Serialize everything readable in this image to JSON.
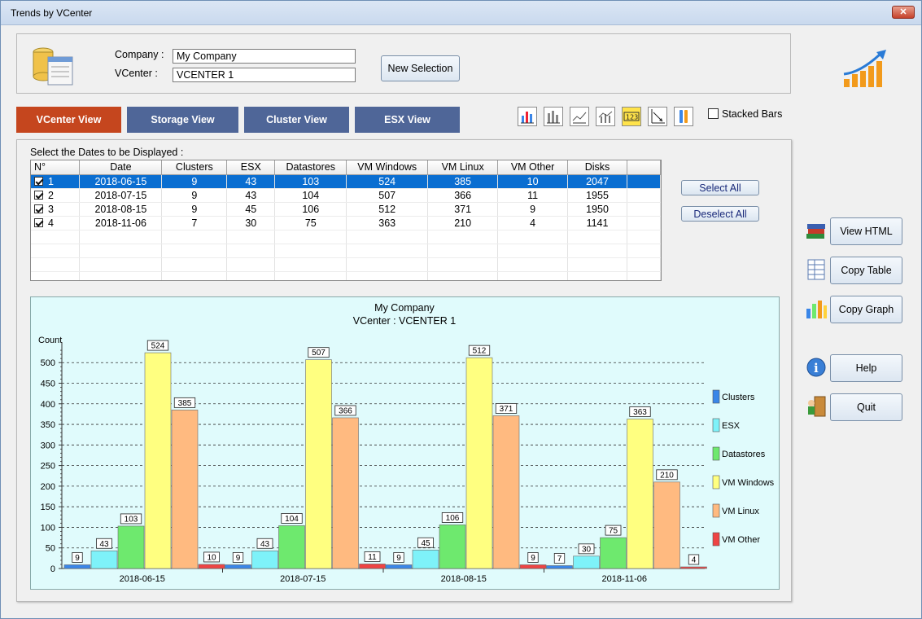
{
  "window": {
    "title": "Trends by VCenter",
    "close_icon": "close-icon"
  },
  "selection": {
    "company_label": "Company :",
    "company_value": "My Company",
    "vcenter_label": "VCenter :",
    "vcenter_value": "VCENTER 1",
    "new_selection": "New Selection"
  },
  "tabs": [
    {
      "label": "VCenter View",
      "active": true,
      "color": "#c5461e"
    },
    {
      "label": "Storage View",
      "active": false,
      "color": "#4f6698"
    },
    {
      "label": "Cluster View",
      "active": false,
      "color": "#4f6698"
    },
    {
      "label": "ESX View",
      "active": false,
      "color": "#4f6698"
    }
  ],
  "toolbar": {
    "icons": [
      "bar-chart-icon",
      "bar-chart-3d-icon",
      "line-chart-icon",
      "line-bar-chart-icon",
      "number-labels-icon",
      "axis-icon",
      "settings-icon"
    ],
    "stacked_label": "Stacked Bars",
    "stacked_checked": false
  },
  "dates": {
    "prompt": "Select the Dates to be Displayed  :",
    "columns": [
      "N°",
      "Date",
      "Clusters",
      "ESX",
      "Datastores",
      "VM Windows",
      "VM Linux",
      "VM Other",
      "Disks"
    ],
    "rows": [
      {
        "n": "1",
        "date": "2018-06-15",
        "clusters": "9",
        "esx": "43",
        "datastores": "103",
        "vmwin": "524",
        "vmlinux": "385",
        "vmother": "10",
        "disks": "2047",
        "checked": true,
        "selected": true
      },
      {
        "n": "2",
        "date": "2018-07-15",
        "clusters": "9",
        "esx": "43",
        "datastores": "104",
        "vmwin": "507",
        "vmlinux": "366",
        "vmother": "11",
        "disks": "1955",
        "checked": true,
        "selected": false
      },
      {
        "n": "3",
        "date": "2018-08-15",
        "clusters": "9",
        "esx": "45",
        "datastores": "106",
        "vmwin": "512",
        "vmlinux": "371",
        "vmother": "9",
        "disks": "1950",
        "checked": true,
        "selected": false
      },
      {
        "n": "4",
        "date": "2018-11-06",
        "clusters": "7",
        "esx": "30",
        "datastores": "75",
        "vmwin": "363",
        "vmlinux": "210",
        "vmother": "4",
        "disks": "1141",
        "checked": true,
        "selected": false
      }
    ],
    "select_all": "Select All",
    "deselect_all": "Deselect All"
  },
  "side": {
    "view_html": "View HTML",
    "copy_table": "Copy Table",
    "copy_graph": "Copy Graph",
    "help": "Help",
    "quit": "Quit"
  },
  "chart_data": {
    "type": "bar",
    "title": "My Company",
    "subtitle": "VCenter : VCENTER 1",
    "ylabel": "Count",
    "xlabel": "",
    "ylim": [
      0,
      540
    ],
    "yticks": [
      0,
      50,
      100,
      150,
      200,
      250,
      300,
      350,
      400,
      450,
      500
    ],
    "grid": true,
    "legend_position": "right",
    "categories": [
      "2018-06-15",
      "2018-07-15",
      "2018-08-15",
      "2018-11-06"
    ],
    "series": [
      {
        "name": "Clusters",
        "color": "#3a86e8",
        "values": [
          9,
          9,
          9,
          7
        ]
      },
      {
        "name": "ESX",
        "color": "#7ef2f9",
        "values": [
          43,
          43,
          45,
          30
        ]
      },
      {
        "name": "Datastores",
        "color": "#6ee96e",
        "values": [
          103,
          104,
          106,
          75
        ]
      },
      {
        "name": "VM Windows",
        "color": "#ffff80",
        "values": [
          524,
          507,
          512,
          363
        ]
      },
      {
        "name": "VM Linux",
        "color": "#ffba80",
        "values": [
          385,
          366,
          371,
          210
        ]
      },
      {
        "name": "VM Other",
        "color": "#ee4444",
        "values": [
          10,
          11,
          9,
          4
        ]
      }
    ]
  }
}
